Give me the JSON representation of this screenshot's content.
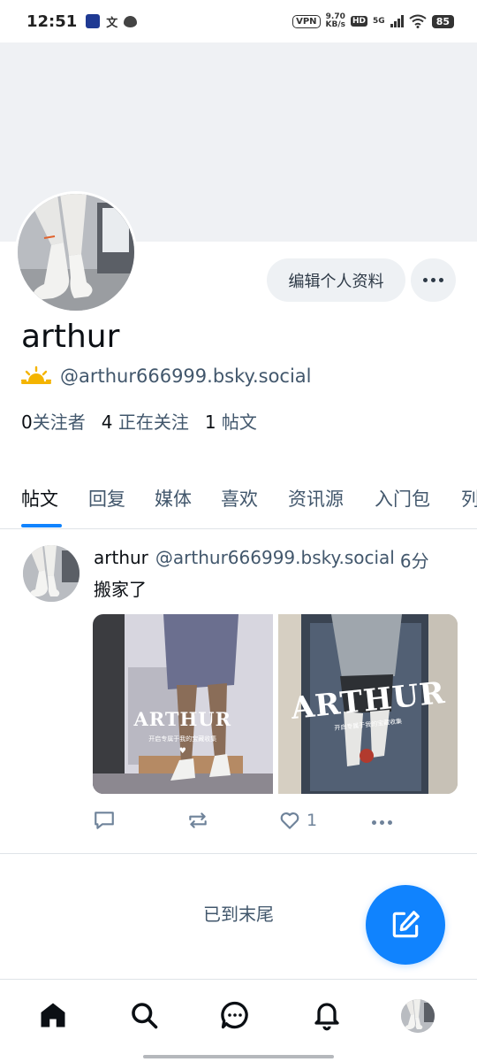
{
  "status_bar": {
    "time": "12:51",
    "left_text_icon": "文",
    "vpn": "VPN",
    "speed_value": "9.70",
    "speed_unit": "KB/s",
    "hd": "HD",
    "network": "5G",
    "battery": "85"
  },
  "profile": {
    "display_name": "arthur",
    "handle_emoji": "sun-behind-cloud-icon",
    "handle": "@arthur666999.bsky.social",
    "edit_button": "编辑个人资料",
    "stats": {
      "followers_count": "0",
      "followers_label": "关注者",
      "following_count": "4",
      "following_label": "正在关注",
      "posts_count": "1",
      "posts_label": "帖文"
    }
  },
  "tabs": [
    "帖文",
    "回复",
    "媒体",
    "喜欢",
    "资讯源",
    "入门包",
    "列表"
  ],
  "active_tab": "帖文",
  "post": {
    "author": "arthur",
    "handle": "@arthur666999.bsky.social",
    "time": "6分",
    "text": "搬家了",
    "images": [
      {
        "watermark": "ARTHUR",
        "caption": "开启专属于我的宝藏收集"
      },
      {
        "watermark": "ARTHUR",
        "caption": "开启专属于我的宝藏收集"
      }
    ],
    "like_count": "1"
  },
  "feed_end_text": "已到末尾",
  "colors": {
    "accent": "#1083fe",
    "text_primary": "#0b0f14",
    "text_secondary": "#42576c",
    "banner": "#eff1f4",
    "button_bg": "#eef1f4"
  }
}
